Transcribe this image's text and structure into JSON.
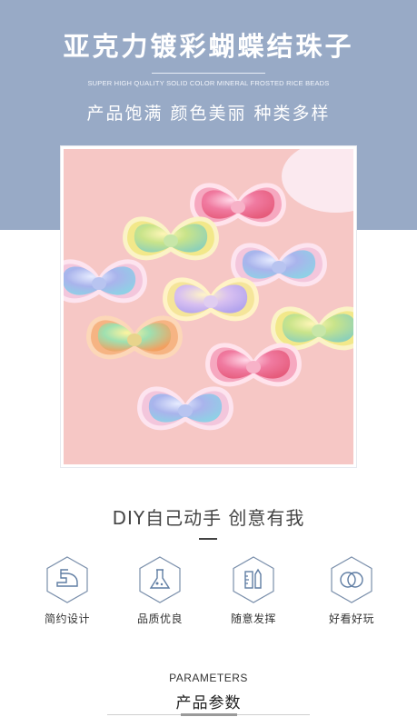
{
  "header": {
    "title": "亚克力镀彩蝴蝶结珠子",
    "subtitle_en": "SUPER HIGH QUALITY SOLID COLOR MINERAL FROSTED RICE BEADS",
    "slogan": "产品饱满 颜色美丽 种类多样"
  },
  "colors": {
    "band": "#98aac6",
    "photo_bg": "#f6c7c5",
    "icon_stroke": "#6a86a8"
  },
  "diy": {
    "text": "DIY自己动手 创意有我"
  },
  "features": [
    {
      "label": "简约设计",
      "icon": "iron-icon"
    },
    {
      "label": "品质优良",
      "icon": "flask-icon"
    },
    {
      "label": "随意发挥",
      "icon": "ruler-pencil-icon"
    },
    {
      "label": "好看好玩",
      "icon": "rings-icon"
    }
  ],
  "parameters": {
    "title_en": "PARAMETERS",
    "title_cn": "产品参数"
  }
}
